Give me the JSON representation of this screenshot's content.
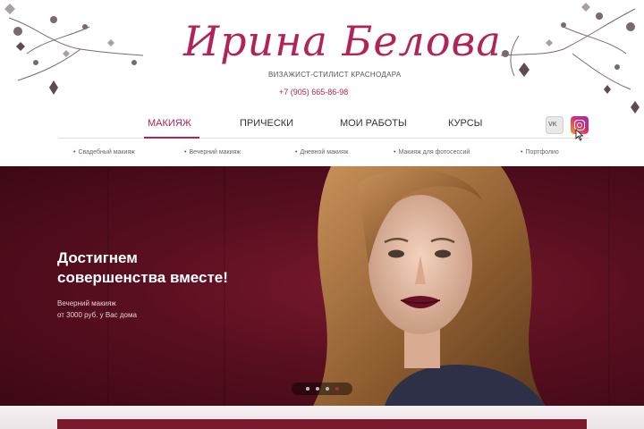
{
  "header": {
    "logo_text": "Ирина Белова",
    "subtitle": "ВИЗАЖИСТ-СТИЛИСТ КРАСНОДАРА",
    "phone": "+7 (905) 665-86-98"
  },
  "nav": {
    "items": [
      {
        "label": "МАКИЯЖ",
        "active": true
      },
      {
        "label": "ПРИЧЕСКИ",
        "active": false
      },
      {
        "label": "МОИ РАБОТЫ",
        "active": false
      },
      {
        "label": "КУРСЫ",
        "active": false
      }
    ],
    "accent_color": "#b0245a"
  },
  "social": {
    "vk_label": "VK",
    "vk_icon": "vk-icon",
    "ig_icon": "instagram-icon"
  },
  "subnav": {
    "items": [
      {
        "label": "Свадебный макияж"
      },
      {
        "label": "Вечерний макияж"
      },
      {
        "label": "Дневной макияж"
      },
      {
        "label": "Макияж для фотосессий"
      },
      {
        "label": "Портфолио"
      }
    ]
  },
  "hero": {
    "title_line1": "Достигнем",
    "title_line2": "совершенства вместе!",
    "desc_line1": "Вечерний макияж",
    "desc_line2": "от 3000 руб. у Вас дома",
    "background_color": "#5a0f20",
    "slides_total": 4,
    "slide_active": 4
  }
}
